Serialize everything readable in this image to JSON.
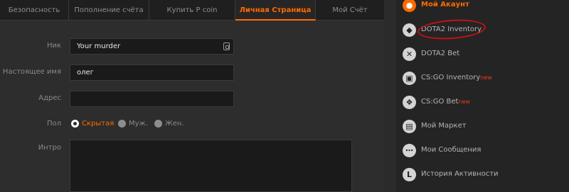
{
  "tabs": [
    {
      "label": "Безопасность"
    },
    {
      "label": "Пополнение счёта"
    },
    {
      "label": "Купить Р coin"
    },
    {
      "label": "Личная Страница"
    },
    {
      "label": "Мой Счёт"
    }
  ],
  "form": {
    "nick_label": "Ник",
    "nick_value": "Your murder",
    "realname_label": "Настоящее имя",
    "realname_value": "олег",
    "address_label": "Адрес",
    "address_value": "",
    "gender_label": "Пол",
    "gender_options": [
      "Скрытая",
      "Муж.",
      "Жен."
    ],
    "gender_selected": "Скрытая",
    "intro_label": "Интро",
    "intro_value": ""
  },
  "sidebar": {
    "items": [
      {
        "label": "Мой Акаунт",
        "icon": "user-icon",
        "badge": ""
      },
      {
        "label": "DOTA2 Inventory",
        "icon": "dota-icon",
        "badge": ""
      },
      {
        "label": "DOTA2 Bet",
        "icon": "swords-icon",
        "badge": ""
      },
      {
        "label": "CS:GO Inventory",
        "icon": "cube-icon",
        "badge": "new"
      },
      {
        "label": "CS:GO Bet",
        "icon": "runner-icon",
        "badge": "new"
      },
      {
        "label": "Мой Маркет",
        "icon": "basket-icon",
        "badge": ""
      },
      {
        "label": "Мои Сообщения",
        "icon": "chat-icon",
        "badge": ""
      },
      {
        "label": "История Активности",
        "icon": "history-icon",
        "badge": ""
      }
    ]
  },
  "colors": {
    "accent": "#ff6a00",
    "annotation": "#c41212",
    "new_badge": "#e63a1b"
  }
}
